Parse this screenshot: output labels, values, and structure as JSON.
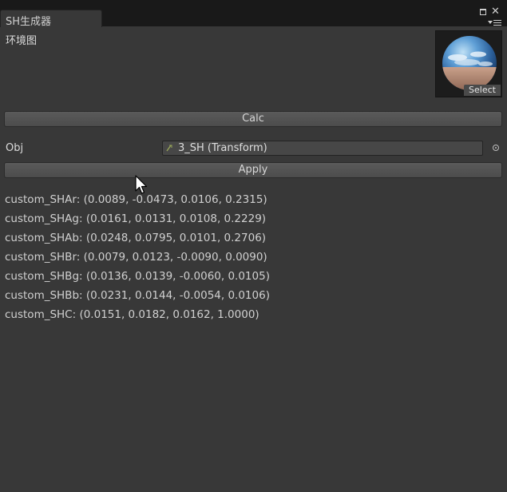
{
  "window": {
    "tab_title": "SH生成器"
  },
  "icons": {
    "maximize": "maximize-icon",
    "close": "close-icon",
    "menu": "window-menu-icon",
    "transform": "transform-icon",
    "picker": "object-picker-icon",
    "cursor": "mouse-cursor-icon"
  },
  "environment": {
    "label": "环境图",
    "select_label": "Select"
  },
  "calc_button": "Calc",
  "obj_field": {
    "label": "Obj",
    "value": "3_SH (Transform)"
  },
  "apply_button": "Apply",
  "sh_coefficients": [
    "custom_SHAr: (0.0089, -0.0473, 0.0106, 0.2315)",
    "custom_SHAg: (0.0161, 0.0131, 0.0108, 0.2229)",
    "custom_SHAb: (0.0248, 0.0795, 0.0101, 0.2706)",
    "custom_SHBr: (0.0079, 0.0123, -0.0090, 0.0090)",
    "custom_SHBg: (0.0136, 0.0139, -0.0060, 0.0105)",
    "custom_SHBb: (0.0231, 0.0144, -0.0054, 0.0106)",
    "custom_SHC: (0.0151, 0.0182, 0.0162, 1.0000)"
  ],
  "colors": {
    "panel_bg": "#383838",
    "tabbar_bg": "#191919",
    "button_bg": "#555555",
    "text": "#d0d0d0"
  }
}
